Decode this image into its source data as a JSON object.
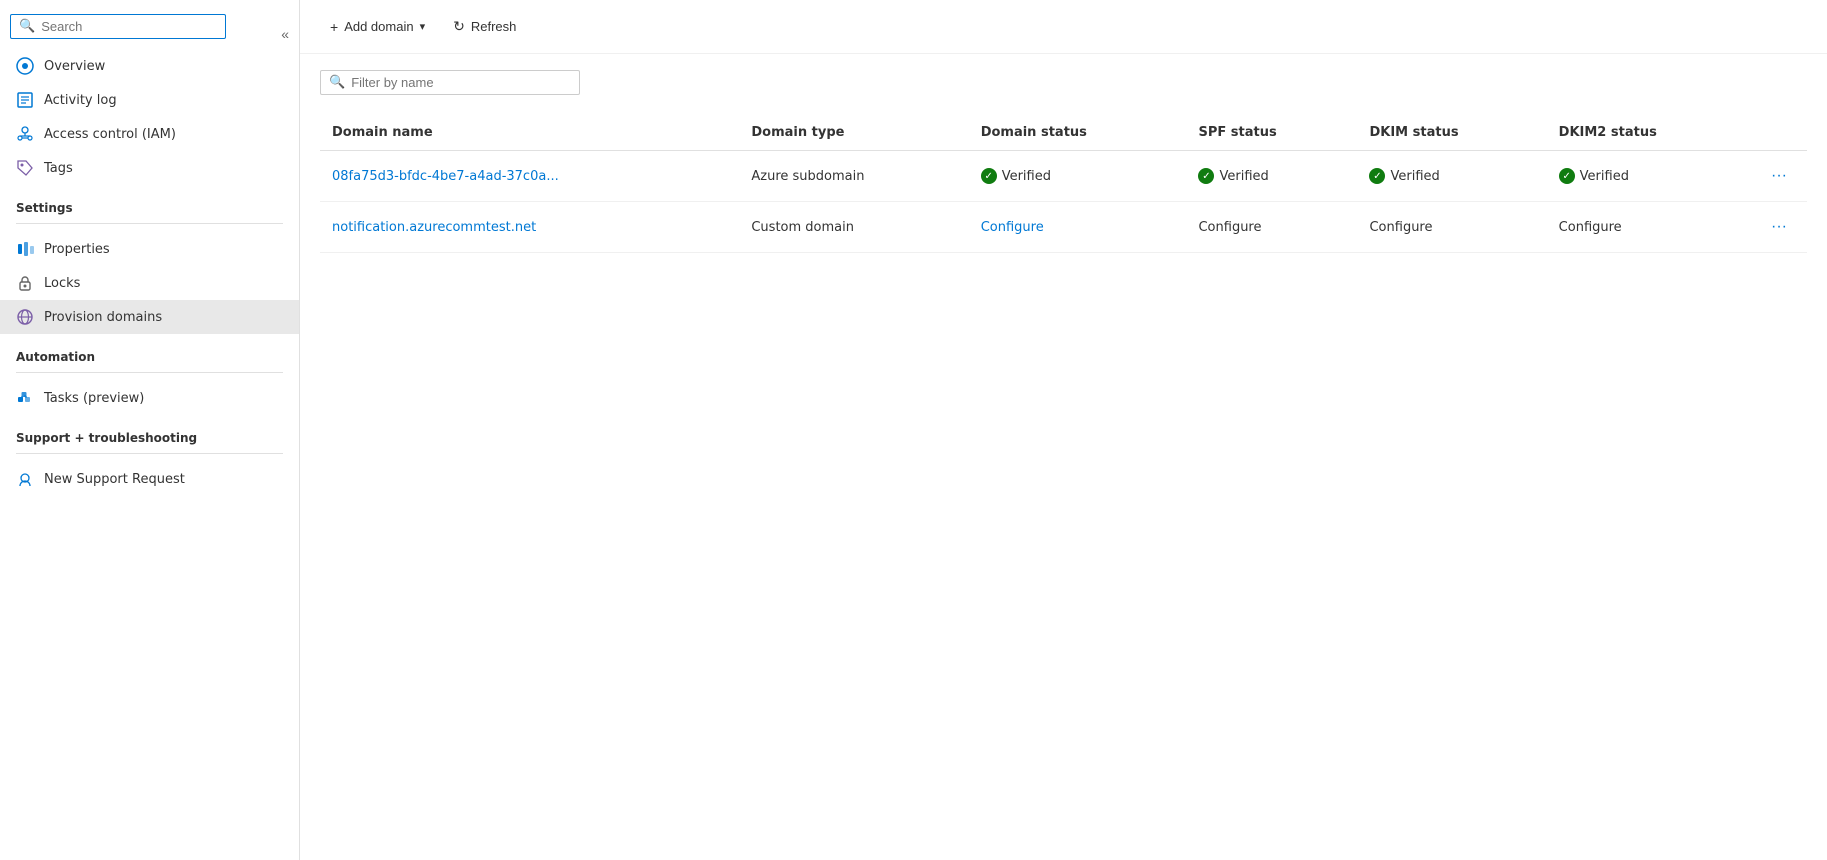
{
  "sidebar": {
    "search_placeholder": "Search",
    "collapse_label": "«",
    "nav_items": [
      {
        "id": "overview",
        "label": "Overview",
        "icon": "overview-icon",
        "active": false
      },
      {
        "id": "activity-log",
        "label": "Activity log",
        "icon": "activity-icon",
        "active": false
      },
      {
        "id": "iam",
        "label": "Access control (IAM)",
        "icon": "iam-icon",
        "active": false
      },
      {
        "id": "tags",
        "label": "Tags",
        "icon": "tags-icon",
        "active": false
      }
    ],
    "sections": [
      {
        "header": "Settings",
        "items": [
          {
            "id": "properties",
            "label": "Properties",
            "icon": "properties-icon",
            "active": false
          },
          {
            "id": "locks",
            "label": "Locks",
            "icon": "locks-icon",
            "active": false
          },
          {
            "id": "provision-domains",
            "label": "Provision domains",
            "icon": "provision-icon",
            "active": true
          }
        ]
      },
      {
        "header": "Automation",
        "items": [
          {
            "id": "tasks",
            "label": "Tasks (preview)",
            "icon": "tasks-icon",
            "active": false
          }
        ]
      },
      {
        "header": "Support + troubleshooting",
        "items": [
          {
            "id": "support",
            "label": "New Support Request",
            "icon": "support-icon",
            "active": false
          }
        ]
      }
    ]
  },
  "toolbar": {
    "add_domain_label": "Add domain",
    "add_domain_chevron": "∨",
    "refresh_label": "Refresh"
  },
  "filter": {
    "placeholder": "Filter by name"
  },
  "table": {
    "columns": [
      {
        "id": "domain-name",
        "label": "Domain name"
      },
      {
        "id": "domain-type",
        "label": "Domain type"
      },
      {
        "id": "domain-status",
        "label": "Domain status"
      },
      {
        "id": "spf-status",
        "label": "SPF status"
      },
      {
        "id": "dkim-status",
        "label": "DKIM status"
      },
      {
        "id": "dkim2-status",
        "label": "DKIM2 status"
      }
    ],
    "rows": [
      {
        "domain_name": "08fa75d3-bfdc-4be7-a4ad-37c0a...",
        "domain_type": "Azure subdomain",
        "domain_status": "Verified",
        "domain_status_type": "verified",
        "spf_status": "Verified",
        "spf_status_type": "verified",
        "dkim_status": "Verified",
        "dkim_status_type": "verified",
        "dkim2_status": "Verified",
        "dkim2_status_type": "verified"
      },
      {
        "domain_name": "notification.azurecommtest.net",
        "domain_type": "Custom domain",
        "domain_status": "Configure",
        "domain_status_type": "configure-link",
        "spf_status": "Configure",
        "spf_status_type": "configure-muted",
        "dkim_status": "Configure",
        "dkim_status_type": "configure-muted",
        "dkim2_status": "Configure",
        "dkim2_status_type": "configure-muted"
      }
    ]
  }
}
